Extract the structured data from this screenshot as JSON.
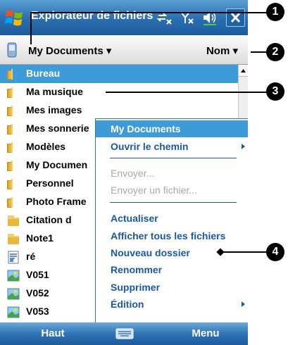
{
  "window": {
    "title": "Explorateur de fichiers",
    "icons": [
      "windows-start-flag-icon",
      "connectivity-icon",
      "signal-off-icon",
      "volume-icon",
      "close-icon"
    ],
    "close_label": "✕"
  },
  "folder_bar": {
    "folder": "My Documents",
    "sort": "Nom"
  },
  "files": [
    {
      "label": "Bureau",
      "icon": "folder-icon",
      "selected": true
    },
    {
      "label": "Ma musique",
      "icon": "folder-icon"
    },
    {
      "label": "Mes images",
      "icon": "folder-icon"
    },
    {
      "label": "Mes sonnerie",
      "icon": "folder-icon"
    },
    {
      "label": "Modèles",
      "icon": "folder-icon"
    },
    {
      "label": "My Documen",
      "icon": "folder-icon"
    },
    {
      "label": "Personnel",
      "icon": "folder-icon"
    },
    {
      "label": "Photo Frame",
      "icon": "folder-icon"
    },
    {
      "label": "Citation d",
      "icon": "note-icon"
    },
    {
      "label": "Note1",
      "icon": "note-icon"
    },
    {
      "label": "ré",
      "icon": "document-icon"
    },
    {
      "label": "V051",
      "icon": "image-icon"
    },
    {
      "label": "V052",
      "icon": "image-icon"
    },
    {
      "label": "V053",
      "icon": "image-icon"
    }
  ],
  "context_menu": {
    "header": "My Documents",
    "items": [
      {
        "label": "Ouvrir le chemin",
        "submenu": true
      },
      {
        "label": "Envoyer...",
        "disabled": true
      },
      {
        "label": "Envoyer un fichier...",
        "disabled": true
      },
      {
        "label": "Actualiser"
      },
      {
        "label": "Afficher tous les fichiers"
      },
      {
        "label": "Nouveau dossier"
      },
      {
        "label": "Renommer"
      },
      {
        "label": "Supprimer"
      },
      {
        "label": "Édition",
        "submenu": true
      }
    ]
  },
  "soft_keys": {
    "left": "Haut",
    "right": "Menu",
    "keyboard_icon": "keyboard-icon"
  },
  "callouts": [
    "1",
    "2",
    "3",
    "4"
  ],
  "colors": {
    "titlebar": "#2f74b5",
    "selection": "#3d9bd8",
    "menu_text": "#1a58a6",
    "disabled_text": "#a7a7a7",
    "folder": "#e8b83a"
  }
}
